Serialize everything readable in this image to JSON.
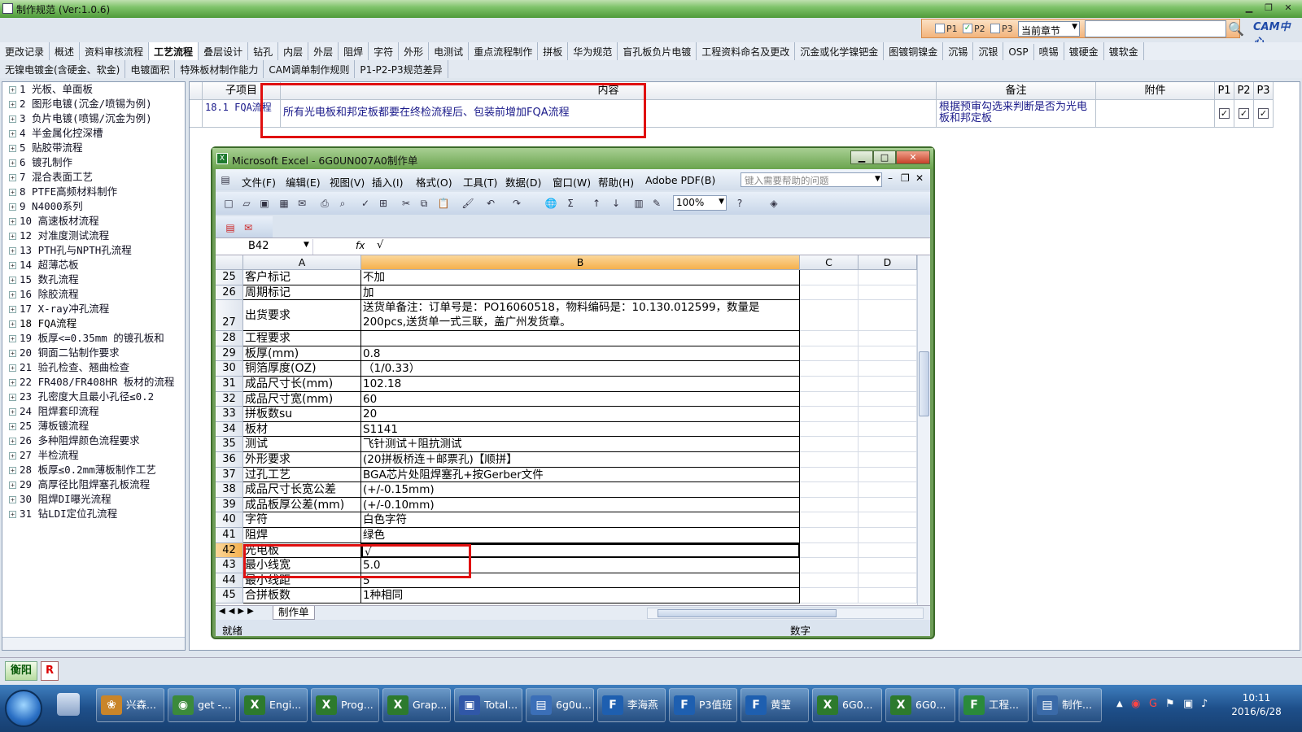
{
  "app": {
    "title": "制作规范 (Ver:1.0.6)"
  },
  "filter": {
    "p1": "P1",
    "p2": "P2",
    "p3": "P3",
    "p1_checked": false,
    "p2_checked": true,
    "p3_checked": false,
    "chapter": "当前章节",
    "search_value": "",
    "logo": "CAM中心"
  },
  "tabs_row1": [
    "更改记录",
    "概述",
    "资料审核流程",
    "工艺流程",
    "叠层设计",
    "钻孔",
    "内层",
    "外层",
    "阻焊",
    "字符",
    "外形",
    "电测试",
    "重点流程制作",
    "拼板",
    "华为规范",
    "盲孔板负片电镀",
    "工程资料命名及更改",
    "沉金或化学镍钯金",
    "图镀铜镍金",
    "沉锡",
    "沉银",
    "OSP",
    "喷锡",
    "镀硬金",
    "镀软金"
  ],
  "tabs_row1_active": "工艺流程",
  "tabs_row2": [
    "无镍电镀金(含硬金、软金)",
    "电镀面积",
    "特殊板材制作能力",
    "CAM调单制作规则",
    "P1-P2-P3规范差异"
  ],
  "tree": [
    "1 光板、单面板",
    "2 图形电镀(沉金/喷锡为例)",
    "3 负片电镀(喷锡/沉金为例)",
    "4 半金属化控深槽",
    "5 贴胶带流程",
    "6 镀孔制作",
    "7 混合表面工艺",
    "8 PTFE高频材料制作",
    "9 N4000系列",
    "10 高速板材流程",
    "12 对准度测试流程",
    "13 PTH孔与NPTH孔流程",
    "14 超薄芯板",
    "15 数孔流程",
    "16 除胶流程",
    "17 X-ray冲孔流程",
    "18 FQA流程",
    "19 板厚<=0.35mm 的镀孔板和",
    "20 铜面二钻制作要求",
    "21 验孔检查、翘曲检查",
    "22 FR408/FR408HR 板材的流程",
    "23 孔密度大且最小孔径≤0.2",
    "24 阻焊套印流程",
    "25 薄板镀流程",
    "26 多种阻焊颜色流程要求",
    "27 半检流程",
    "28 板厚≤0.2mm薄板制作工艺",
    "29 高厚径比阻焊塞孔板流程",
    "30 阻焊DI曝光流程",
    "31 钻LDI定位孔流程"
  ],
  "grid": {
    "headers": {
      "sub": "子项目",
      "content": "内容",
      "remark": "备注",
      "attach": "附件",
      "p1": "P1",
      "p2": "P2",
      "p3": "P3"
    },
    "row": {
      "sub": "18.1 FQA流程",
      "content": "所有光电板和邦定板都要在终检流程后、包装前增加FQA流程",
      "remark": "根据预审勾选来判断是否为光电板和邦定板",
      "attach": "",
      "p1": true,
      "p2": true,
      "p3": true
    }
  },
  "excel": {
    "title": "Microsoft Excel - 6G0UN007A0制作单",
    "menus": [
      "文件(F)",
      "编辑(E)",
      "视图(V)",
      "插入(I)",
      "格式(O)",
      "工具(T)",
      "数据(D)",
      "窗口(W)",
      "帮助(H)",
      "Adobe PDF(B)"
    ],
    "help_placeholder": "键入需要帮助的问题",
    "zoom": "100%",
    "name_box": "B42",
    "fx": "fx",
    "formula": "√",
    "columns": [
      "A",
      "B",
      "C",
      "D"
    ],
    "rows": [
      {
        "n": "25",
        "a": "客户标记",
        "b": "不加"
      },
      {
        "n": "26",
        "a": "周期标记",
        "b": "加"
      },
      {
        "n": "27",
        "a": "出货要求",
        "b": "送货单备注：订单号是：PO16060518，物料编码是：10.130.012599，数量是",
        "b2": "200pcs,送货单一式三联，盖广州发货章。"
      },
      {
        "n": "28",
        "a": "工程要求",
        "b": ""
      },
      {
        "n": "29",
        "a": "板厚(mm)",
        "b": "0.8"
      },
      {
        "n": "30",
        "a": "铜箔厚度(OZ)",
        "b": "（1/0.33）"
      },
      {
        "n": "31",
        "a": "成品尺寸长(mm)",
        "b": "102.18"
      },
      {
        "n": "32",
        "a": "成品尺寸宽(mm)",
        "b": "60"
      },
      {
        "n": "33",
        "a": "拼板数su",
        "b": "20"
      },
      {
        "n": "34",
        "a": "板材",
        "b": "S1141"
      },
      {
        "n": "35",
        "a": "测试",
        "b": "飞针测试＋阻抗测试"
      },
      {
        "n": "36",
        "a": "外形要求",
        "b": "(20拼板桥连＋邮票孔)【顺拼】"
      },
      {
        "n": "37",
        "a": "过孔工艺",
        "b": "BGA芯片处阻焊塞孔+按Gerber文件"
      },
      {
        "n": "38",
        "a": "成品尺寸长宽公差",
        "b": "(+/-0.15mm)"
      },
      {
        "n": "39",
        "a": "成品板厚公差(mm)",
        "b": "(+/-0.10mm)"
      },
      {
        "n": "40",
        "a": "字符",
        "b": "白色字符"
      },
      {
        "n": "41",
        "a": "阻焊",
        "b": "绿色"
      },
      {
        "n": "42",
        "a": "光电板",
        "b": "√"
      },
      {
        "n": "43",
        "a": "最小线宽",
        "b": "5.0"
      },
      {
        "n": "44",
        "a": "最小线距",
        "b": "5"
      },
      {
        "n": "45",
        "a": "合拼板数",
        "b": "1种相同"
      }
    ],
    "sheet_tab": "制作单",
    "status_left": "就绪",
    "status_right": "数字"
  },
  "bottom": {
    "btn_hy": "衡阳",
    "btn_r": "R"
  },
  "taskbar": {
    "items": [
      "兴森...",
      "get -...",
      "Engi...",
      "Prog...",
      "Grap...",
      "Total...",
      "6g0u...",
      "李海燕",
      "P3值班",
      "黄莹",
      "6G0...",
      "6G0...",
      "工程...",
      "制作..."
    ],
    "time": "10:11",
    "date": "2016/6/28"
  }
}
